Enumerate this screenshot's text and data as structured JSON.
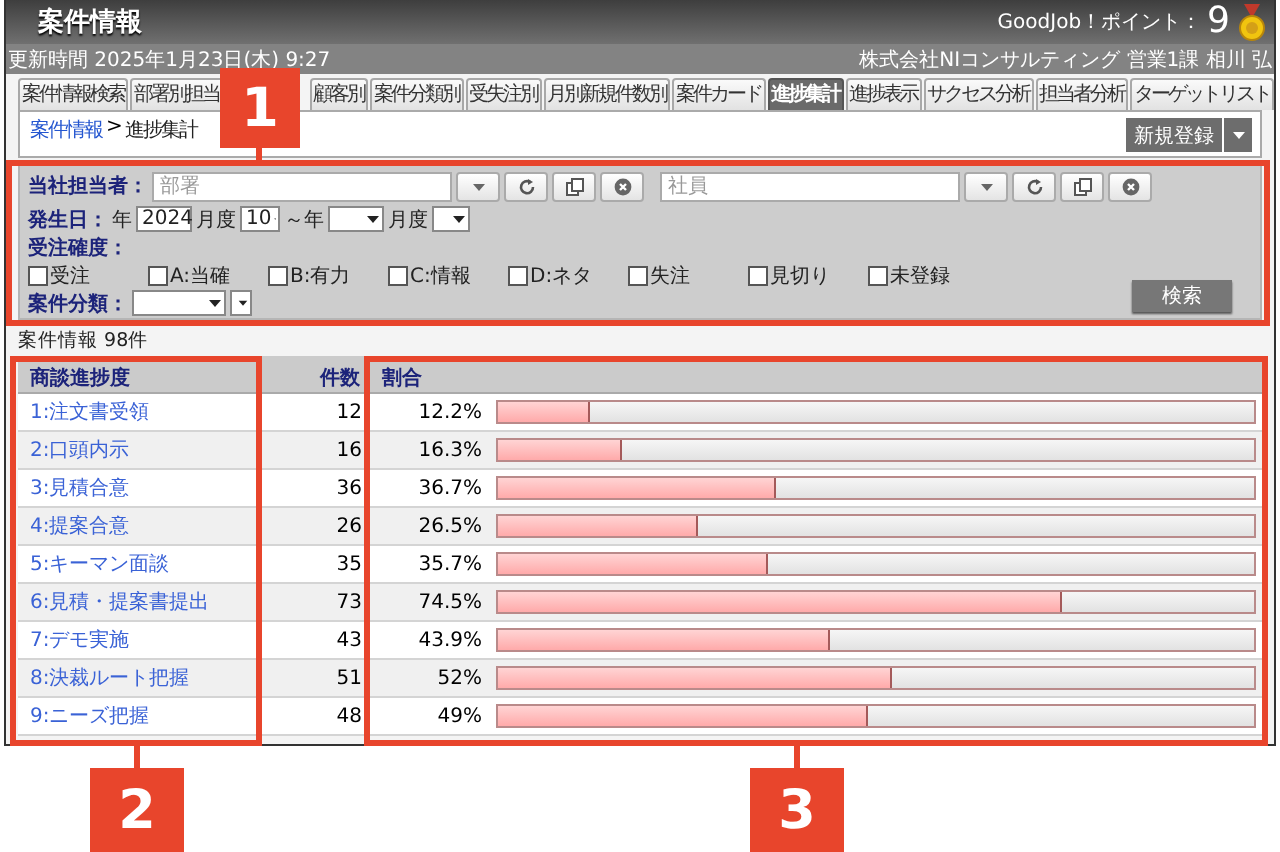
{
  "header": {
    "title": "案件情報",
    "points_label": "GoodJob！ポイント：",
    "points": "9"
  },
  "info_bar": {
    "updated": "更新時間 2025年1月23日(木) 9:27",
    "user": "株式会社NIコンサルティング 営業1課 相川 弘"
  },
  "tabs": [
    {
      "label": "案件情報検索",
      "selected": false
    },
    {
      "label": "部署別担当",
      "selected": false
    },
    {
      "label": "顧客別",
      "selected": false
    },
    {
      "label": "案件分類別",
      "selected": false
    },
    {
      "label": "受失注別",
      "selected": false
    },
    {
      "label": "月別新規件数別",
      "selected": false
    },
    {
      "label": "案件カード",
      "selected": false
    },
    {
      "label": "進捗集計",
      "selected": true
    },
    {
      "label": "進捗表示",
      "selected": false
    },
    {
      "label": "サクセス分析",
      "selected": false
    },
    {
      "label": "担当者分析",
      "selected": false
    },
    {
      "label": "ターゲットリスト",
      "selected": false
    }
  ],
  "breadcrumb": {
    "items": [
      {
        "label": "案件情報",
        "kind": "link"
      },
      {
        "label": "進捗集計",
        "kind": "current"
      }
    ],
    "separator": ">"
  },
  "new_button": {
    "label": "新規登録"
  },
  "filters": {
    "staff": {
      "label": "当社担当者：",
      "department": {
        "placeholder": "部署"
      },
      "employee": {
        "placeholder": "社員"
      }
    },
    "date": [
      {
        "kind": "label",
        "text": "発生日："
      },
      {
        "kind": "text",
        "text": "年"
      },
      {
        "kind": "select",
        "value": "2024"
      },
      {
        "kind": "text",
        "text": "月度"
      },
      {
        "kind": "select",
        "value": "10"
      },
      {
        "kind": "text",
        "text": "～年"
      },
      {
        "kind": "select"
      },
      {
        "kind": "text",
        "text": "月度"
      },
      {
        "kind": "select"
      }
    ],
    "certainty": {
      "label": "受注確度：",
      "options": [
        {
          "label": "受注",
          "checked": false
        },
        {
          "label": "A:当確",
          "checked": false
        },
        {
          "label": "B:有力",
          "checked": false
        },
        {
          "label": "C:情報",
          "checked": false
        },
        {
          "label": "D:ネタ",
          "checked": false
        },
        {
          "label": "失注",
          "checked": false
        },
        {
          "label": "見切り",
          "checked": false
        },
        {
          "label": "未登録",
          "checked": false
        }
      ]
    },
    "category": {
      "label": "案件分類："
    },
    "search_button": "検索"
  },
  "result_count": "案件情報 98件",
  "table": {
    "columns": [
      "商談進捗度",
      "件数",
      "割合"
    ],
    "rows": [
      {
        "stage": "1:注文書受領",
        "count": "12",
        "percent": "12.2%",
        "level": 0.122
      },
      {
        "stage": "2:口頭内示",
        "count": "16",
        "percent": "16.3%",
        "level": 0.163
      },
      {
        "stage": "3:見積合意",
        "count": "36",
        "percent": "36.7%",
        "level": 0.367
      },
      {
        "stage": "4:提案合意",
        "count": "26",
        "percent": "26.5%",
        "level": 0.265
      },
      {
        "stage": "5:キーマン面談",
        "count": "35",
        "percent": "35.7%",
        "level": 0.357
      },
      {
        "stage": "6:見積・提案書提出",
        "count": "73",
        "percent": "74.5%",
        "level": 0.745
      },
      {
        "stage": "7:デモ実施",
        "count": "43",
        "percent": "43.9%",
        "level": 0.439
      },
      {
        "stage": "8:決裁ルート把握",
        "count": "51",
        "percent": "52%",
        "level": 0.52
      },
      {
        "stage": "9:ニーズ把握",
        "count": "48",
        "percent": "49%",
        "level": 0.49
      }
    ]
  },
  "annotations": [
    {
      "label": "1"
    },
    {
      "label": "2"
    },
    {
      "label": "3"
    }
  ]
}
